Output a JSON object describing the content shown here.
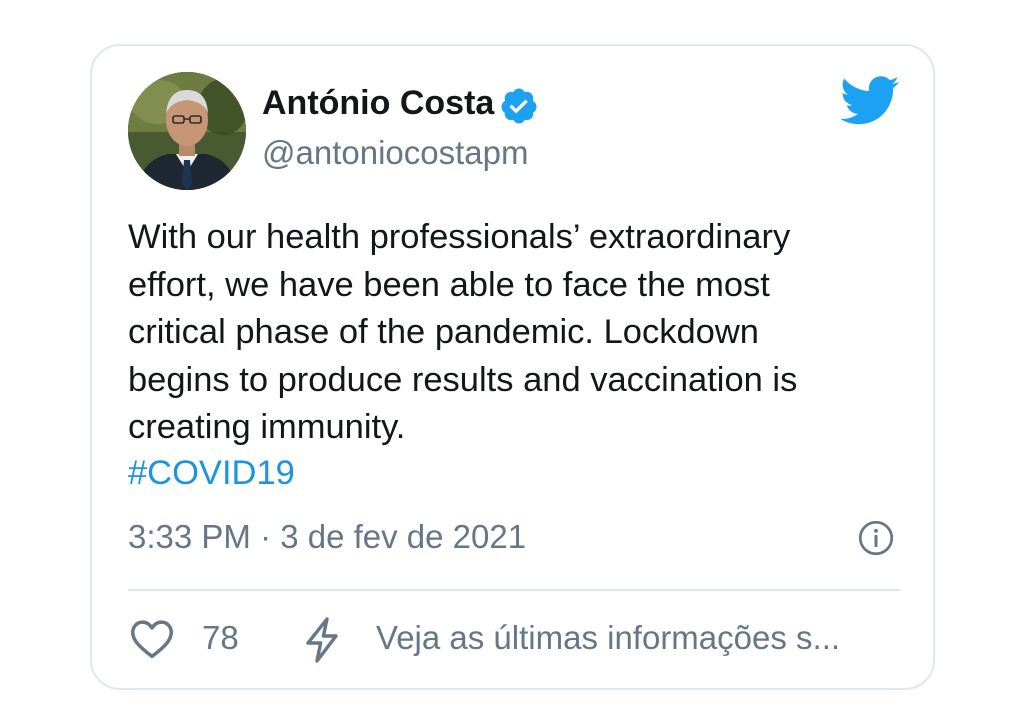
{
  "author": {
    "name": "António Costa",
    "handle": "@antoniocostapm",
    "verified": true,
    "avatar": "portrait-photo"
  },
  "tweet": {
    "text_lines": [
      "With our health professionals’ extraordinary",
      "effort, we have been able to face the most",
      "critical phase of the pandemic. Lockdown",
      "begins to produce results and vaccination is",
      "creating immunity."
    ],
    "hashtag": "#COVID19",
    "timestamp": "3:33 PM · 3 de fev de 2021"
  },
  "actions": {
    "like_count": "78",
    "latest_info_label": "Veja as últimas informações s..."
  },
  "icons": {
    "brand": "twitter-bird-icon",
    "verified": "verified-badge-icon",
    "info": "info-icon",
    "like": "heart-icon",
    "latest": "lightning-bolt-icon"
  },
  "colors": {
    "twitter_blue": "#1da1f2",
    "hashtag": "#1b95e0",
    "text_primary": "#14171a",
    "text_secondary": "#657786",
    "border": "#e1e8ed"
  }
}
